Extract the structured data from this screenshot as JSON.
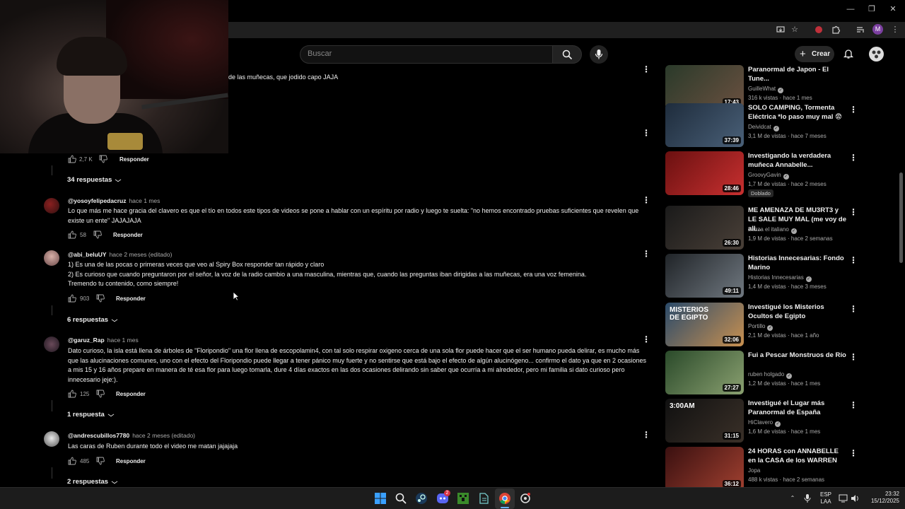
{
  "browser": {
    "window_controls": {
      "minimize": "—",
      "restore": "❐",
      "close": "✕"
    },
    "profile_initial": "M"
  },
  "header": {
    "search_placeholder": "Buscar",
    "create_label": "Crear"
  },
  "comments": {
    "first_partial_text": "de las muñecas, que jodido capo JAJA",
    "first_likes": "2,7 K",
    "first_replies": "34 respuestas",
    "items": [
      {
        "author": "@yosoyfelipedacruz",
        "meta": "hace 1 mes",
        "text": "Lo que más me hace gracia del clavero es que el tío en todos este tipos de videos se pone a hablar con un espíritu por radio y luego te suelta: \"no hemos encontrado pruebas suficientes que revelen que existe un ente\" JAJAJAJA",
        "likes": "58",
        "replies": ""
      },
      {
        "author": "@abi_beluUY",
        "meta": "hace 2 meses (editado)",
        "text_lines": [
          "1) Es una de las pocas o primeras veces que veo al Spiry Box responder tan rápido y claro",
          "2) Es curioso que cuando preguntaron por el señor, la voz de la radio cambio a una masculina, mientras que, cuando las preguntas iban dirigidas a las muñecas, era una voz femenina.",
          "Tremendo tu contenido, como siempre!"
        ],
        "likes": "903",
        "replies": "6 respuestas"
      },
      {
        "author": "@garuz_Rap",
        "meta": "hace 1 mes",
        "text": "Dato curioso, la isla está llena de árboles de \"Floripondio\" una flor llena de escopolamin4, con tal solo respirar oxigeno cerca de una sola flor puede hacer que el ser humano pueda delirar, es mucho más que las alucinaciones comunes, uno con el efecto del Floripondio puede llegar a tener pánico muy fuerte y no sentirse que está bajo el efecto de algún alucinógeno... confirmo el dato ya que en 2 ocasiones a mis 15 y 16 años prepare en manera de té esa flor para luego tomarla, dure 4 días exactos en las dos ocasiones delirando sin saber que ocurría a mi alrededor, pero mi familia si dato curioso pero innecesario jeje:).",
        "likes": "125",
        "replies": "1 respuesta"
      },
      {
        "author": "@andrescubillos7780",
        "meta": "hace 2 meses (editado)",
        "text": "Las caras de Ruben durante todo el video me matan jajajaja",
        "likes": "485",
        "replies": "2 respuestas"
      }
    ],
    "reply_label": "Responder"
  },
  "sidebar": {
    "videos": [
      {
        "title": "Paranormal de Japon - El Tune...",
        "channel": "GuilleWhat",
        "stats": "316 k vistas · hace 1 mes",
        "duration": "17:43",
        "colors": [
          "#2a3a2a",
          "#6a5040"
        ]
      },
      {
        "title": "SOLO CAMPING, Tormenta Eléctrica *lo paso muy mal 😨",
        "channel": "Deividcat",
        "stats": "3,1 M de vistas · hace 7 meses",
        "duration": "37:39",
        "colors": [
          "#1e2c3c",
          "#4a6078"
        ]
      },
      {
        "title": "Investigando la verdadera muñeca Annabelle...",
        "channel": "GroovyGavin",
        "stats": "1,7 M de vistas · hace 2 meses",
        "duration": "28:46",
        "badge": "Doblado",
        "colors": [
          "#6a1010",
          "#c83030"
        ]
      },
      {
        "title": "ME AMENAZA DE MU3RT3 y LE SALE MUY MAL (me voy de all...",
        "channel": "Zazza el italiano",
        "stats": "1,9 M de vistas · hace 2 semanas",
        "duration": "26:30",
        "colors": [
          "#1a1a1a",
          "#4a4038"
        ]
      },
      {
        "title": "Historias Innecesarias: Fondo Marino",
        "channel": "Historias Innecesarias",
        "stats": "1,4 M de vistas · hace 3 meses",
        "duration": "49:11",
        "colors": [
          "#202428",
          "#707880"
        ]
      },
      {
        "title": "Investigué los Misterios Ocultos de Egipto",
        "channel": "Portillo",
        "stats": "2,1 M de vistas · hace 1 año",
        "duration": "32:06",
        "thumb_text": "MISTERIOS DE EGIPTO",
        "colors": [
          "#2a4a6a",
          "#c89050"
        ]
      },
      {
        "title": "Fui a Pescar Monstruos de Río",
        "channel": "ruben holgado",
        "stats": "1,2 M de vistas · hace 1 mes",
        "duration": "27:27",
        "colors": [
          "#2a4a2a",
          "#8aa070"
        ]
      },
      {
        "title": "Investigué el Lugar más Paranormal de España",
        "channel": "HiClavero",
        "stats": "1,6 M de vistas · hace 1 mes",
        "duration": "31:15",
        "thumb_text": "3:00AM",
        "colors": [
          "#101010",
          "#3a3028"
        ]
      },
      {
        "title": "24 HORAS con ANNABELLE en la CASA de los WARREN",
        "channel": "Jopa",
        "stats": "488 k vistas · hace 2 semanas",
        "duration": "36:12",
        "colors": [
          "#3a1010",
          "#a04030"
        ]
      }
    ]
  },
  "taskbar": {
    "lang_top": "ESP",
    "lang_bottom": "LAA",
    "time": "23:32",
    "date": "15/12/2025",
    "discord_badge": "2"
  }
}
